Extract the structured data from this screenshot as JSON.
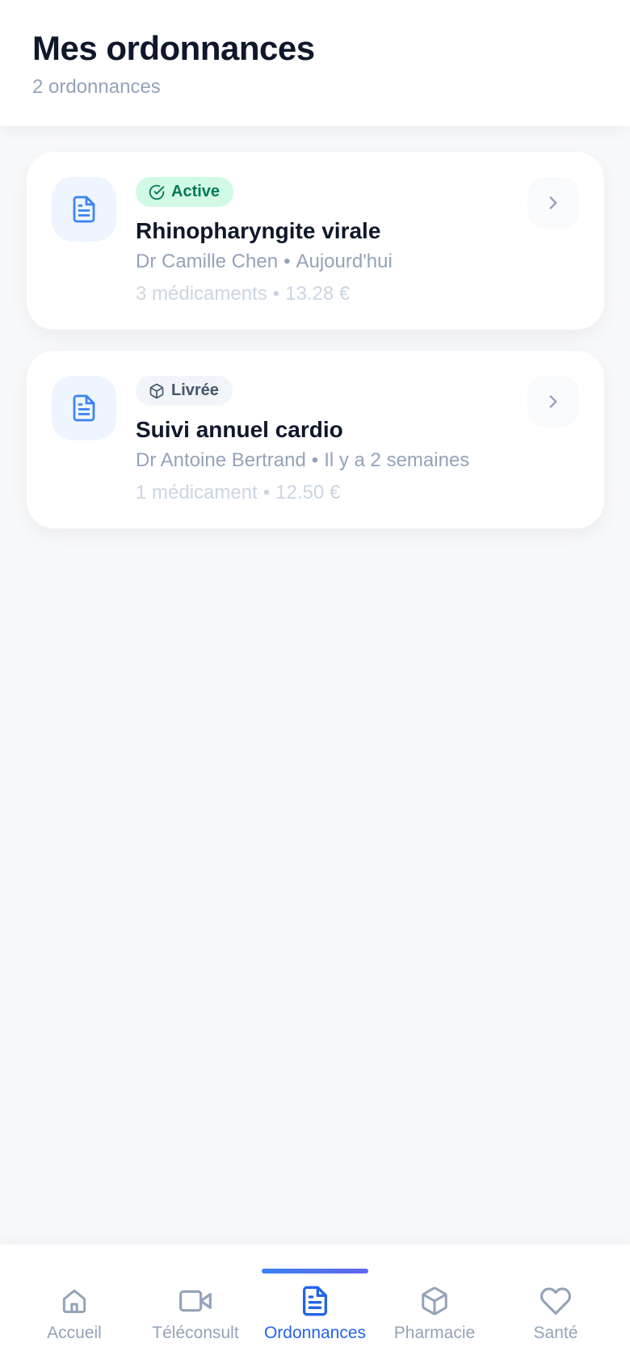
{
  "header": {
    "title": "Mes ordonnances",
    "subtitle": "2 ordonnances"
  },
  "prescriptions": [
    {
      "status": "Active",
      "status_icon": "check-circle-icon",
      "title": "Rhinopharyngite virale",
      "doctor": "Dr Camille Chen",
      "date": "Aujourd'hui",
      "medications": "3 médicaments",
      "price": "13.28 €"
    },
    {
      "status": "Livrée",
      "status_icon": "package-icon",
      "title": "Suivi annuel cardio",
      "doctor": "Dr Antoine Bertrand",
      "date": "Il y a 2 semaines",
      "medications": "1 médicament",
      "price": "12.50 €"
    }
  ],
  "separator": "•",
  "tabbar": {
    "active_index": 2,
    "tabs": [
      {
        "label": "Accueil",
        "icon": "home-icon"
      },
      {
        "label": "Téléconsult",
        "icon": "video-icon"
      },
      {
        "label": "Ordonnances",
        "icon": "document-icon"
      },
      {
        "label": "Pharmacie",
        "icon": "package-icon"
      },
      {
        "label": "Santé",
        "icon": "heart-icon"
      }
    ]
  },
  "colors": {
    "accent": "#2563eb",
    "active_badge_bg": "#d1fae5",
    "active_badge_text": "#047857",
    "muted_text": "#94a3b8",
    "title_text": "#0f172a"
  }
}
